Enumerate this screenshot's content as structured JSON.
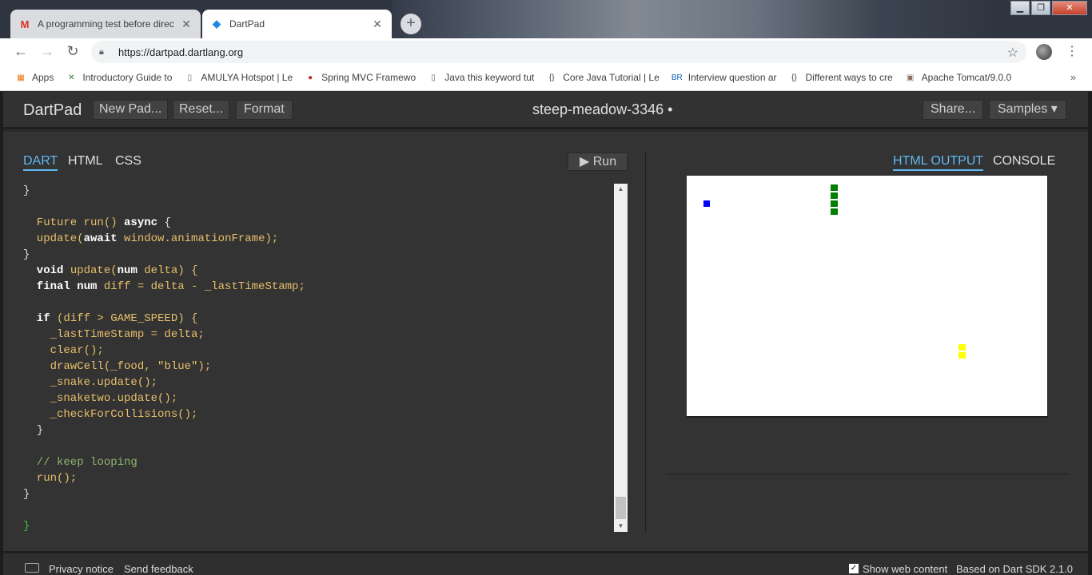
{
  "browser": {
    "tabs": [
      {
        "title": "A programming test before direc",
        "favicon": "M",
        "favicon_color": "#d93025"
      },
      {
        "title": "DartPad",
        "favicon": "◆",
        "favicon_color": "#1e88e5"
      }
    ],
    "close_glyph": "✕",
    "new_tab_glyph": "+",
    "window_buttons": [
      "▁",
      "❐",
      "✕"
    ],
    "url": "https://dartpad.dartlang.org",
    "bookmarks": [
      {
        "label": "Apps",
        "icon": "▦",
        "icon_color": "#e8710a"
      },
      {
        "label": "Introductory Guide to",
        "icon": "✕",
        "icon_color": "#2e7d32"
      },
      {
        "label": "AMULYA Hotspot | Le",
        "icon": "▯",
        "icon_color": "#5f6368"
      },
      {
        "label": "Spring MVC Framewo",
        "icon": "●",
        "icon_color": "#c62828"
      },
      {
        "label": "Java this keyword tut",
        "icon": "▯",
        "icon_color": "#5f6368"
      },
      {
        "label": "Core Java Tutorial | Le",
        "icon": "{}",
        "icon_color": "#3c4043"
      },
      {
        "label": "Interview question ar",
        "icon": "BR",
        "icon_color": "#1565c0"
      },
      {
        "label": "Different ways to cre",
        "icon": "{}",
        "icon_color": "#3c4043"
      },
      {
        "label": "Apache Tomcat/9.0.0",
        "icon": "▣",
        "icon_color": "#8d6e63"
      }
    ],
    "more_glyph": "»"
  },
  "dartpad": {
    "logo": "DartPad",
    "buttons": {
      "new_pad": "New Pad...",
      "reset": "Reset...",
      "format": "Format",
      "share": "Share...",
      "samples": "Samples ▾"
    },
    "title": "steep-meadow-3346 •",
    "editor_tabs": [
      "DART",
      "HTML",
      "CSS"
    ],
    "run": "▶ Run",
    "output_tabs": [
      "HTML OUTPUT",
      "CONSOLE"
    ]
  },
  "code_lines": [
    [
      [
        "p",
        "}"
      ]
    ],
    [],
    [
      [
        "n",
        "  Future run() "
      ],
      [
        "k",
        "async"
      ],
      [
        "p",
        " {"
      ]
    ],
    [
      [
        "n",
        "  update("
      ],
      [
        "k",
        "await"
      ],
      [
        "n",
        " window.animationFrame);"
      ]
    ],
    [
      [
        "p",
        "}"
      ]
    ],
    [
      [
        "k",
        "  void"
      ],
      [
        "n",
        " update("
      ],
      [
        "k",
        "num"
      ],
      [
        "n",
        " delta) {"
      ]
    ],
    [
      [
        "k",
        "  final num"
      ],
      [
        "n",
        " diff = delta - _lastTimeStamp;"
      ]
    ],
    [],
    [
      [
        "k",
        "  if"
      ],
      [
        "n",
        " (diff > GAME_SPEED) {"
      ]
    ],
    [
      [
        "n",
        "    _lastTimeStamp = delta;"
      ]
    ],
    [
      [
        "n",
        "    clear();"
      ]
    ],
    [
      [
        "n",
        "    drawCell(_food, \"blue\");"
      ]
    ],
    [
      [
        "n",
        "    _snake.update();"
      ]
    ],
    [
      [
        "n",
        "    _snaketwo.update();"
      ]
    ],
    [
      [
        "n",
        "    _checkForCollisions();"
      ]
    ],
    [
      [
        "p",
        "  }"
      ]
    ],
    [],
    [
      [
        "c",
        "  // keep looping"
      ]
    ],
    [
      [
        "n",
        "  run();"
      ]
    ],
    [
      [
        "p",
        "}"
      ]
    ],
    [],
    [
      [
        "g",
        "}"
      ]
    ]
  ],
  "footer": {
    "privacy": "Privacy notice",
    "feedback": "Send feedback",
    "show_web": "Show web content",
    "sdk": "Based on Dart SDK 2.1.0"
  },
  "canvas_colors": {
    "food": "#0000ff",
    "snake": "#008000",
    "snaketwo": "#ffff00"
  }
}
